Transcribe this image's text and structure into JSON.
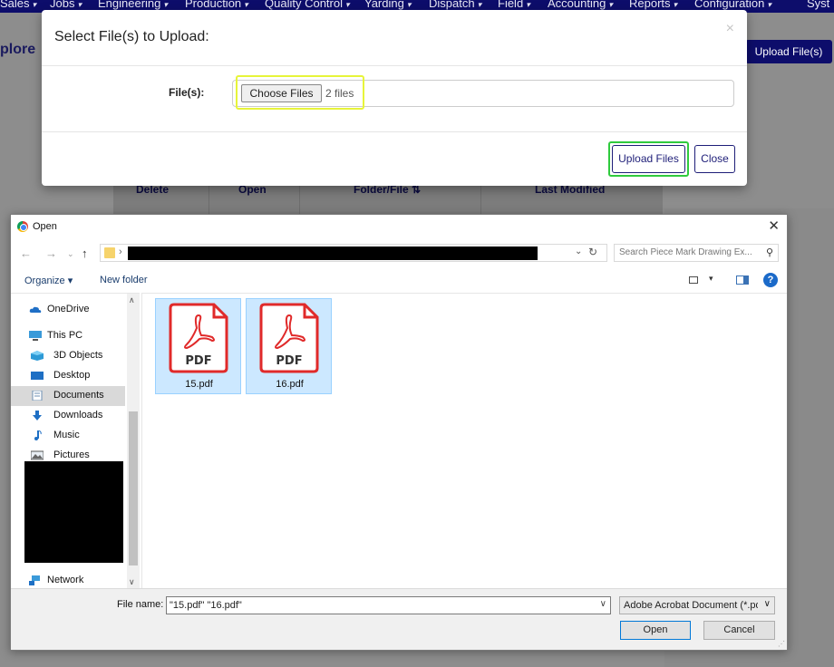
{
  "navbar": {
    "items": [
      "Sales",
      "Jobs",
      "Engineering",
      "Production",
      "Quality Control",
      "Yarding",
      "Dispatch",
      "Field",
      "Accounting",
      "Reports",
      "Configuration",
      "Syst"
    ]
  },
  "background": {
    "page_title": "plore",
    "upload_button": "Upload File(s)",
    "table_headers": [
      "Delete",
      "Open",
      "Folder/File ⇅",
      "Last Modified"
    ]
  },
  "modal": {
    "title": "Select File(s) to Upload:",
    "close_glyph": "×",
    "files_label": "File(s):",
    "choose_button": "Choose Files",
    "file_count": "2 files",
    "upload_button": "Upload Files",
    "close_button": "Close",
    "highlight_colors": {
      "choose": "#e7f43a",
      "upload": "#2fcb3d"
    }
  },
  "dialog": {
    "title": "Open",
    "search_placeholder": "Search Piece Mark Drawing Ex...",
    "toolbar": {
      "organize": "Organize ▾",
      "new_folder": "New folder"
    },
    "sidebar": [
      {
        "label": "OneDrive",
        "icon": "cloud-icon"
      },
      {
        "label": "This PC",
        "icon": "computer-icon"
      },
      {
        "label": "3D Objects",
        "icon": "cube-icon"
      },
      {
        "label": "Desktop",
        "icon": "desktop-icon"
      },
      {
        "label": "Documents",
        "icon": "documents-icon"
      },
      {
        "label": "Downloads",
        "icon": "download-icon"
      },
      {
        "label": "Music",
        "icon": "music-icon"
      },
      {
        "label": "Pictures",
        "icon": "pictures-icon"
      },
      {
        "label": "Network",
        "icon": "network-icon"
      }
    ],
    "files": [
      {
        "name": "15.pdf",
        "badge": "PDF"
      },
      {
        "name": "16.pdf",
        "badge": "PDF"
      }
    ],
    "file_name_label": "File name:",
    "file_name_value": "\"15.pdf\" \"16.pdf\"",
    "file_type": "Adobe Acrobat Document (*.pdf)",
    "open_button": "Open",
    "cancel_button": "Cancel"
  }
}
